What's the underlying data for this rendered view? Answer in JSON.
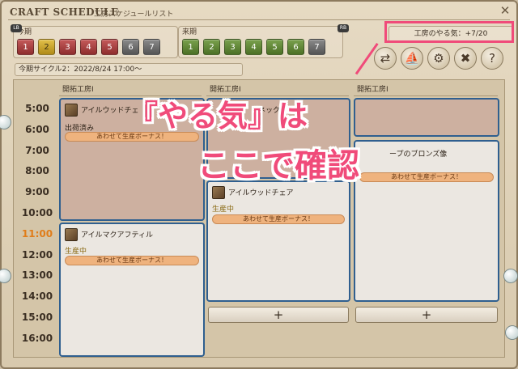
{
  "header": {
    "title": "CRAFT SCHEDULE",
    "subtitle": "工房スケジュールリスト",
    "close_icon": "✕"
  },
  "this_period": {
    "label": "今期",
    "badge": "LB",
    "days": [
      {
        "label": "1",
        "color": "red"
      },
      {
        "label": "2",
        "color": "gold"
      },
      {
        "label": "3",
        "color": "red"
      },
      {
        "label": "4",
        "color": "red"
      },
      {
        "label": "5",
        "color": "red"
      },
      {
        "label": "6",
        "color": "gray"
      },
      {
        "label": "7",
        "color": "gray"
      }
    ]
  },
  "next_period": {
    "label": "来期",
    "badge": "RB",
    "days": [
      {
        "label": "1",
        "color": "green"
      },
      {
        "label": "2",
        "color": "green"
      },
      {
        "label": "3",
        "color": "green"
      },
      {
        "label": "4",
        "color": "green"
      },
      {
        "label": "5",
        "color": "green"
      },
      {
        "label": "6",
        "color": "green"
      },
      {
        "label": "7",
        "color": "gray"
      }
    ]
  },
  "motivation": "工房のやる気：+7/20",
  "tool_icons": [
    "⇄",
    "⛵",
    "⚙",
    "✖",
    "?"
  ],
  "cycle_info": "今期サイクル2：2022/8/24 17:00～",
  "time_labels": [
    "5:00",
    "6:00",
    "7:00",
    "8:00",
    "9:00",
    "10:00",
    "11:00",
    "12:00",
    "13:00",
    "14:00",
    "15:00",
    "16:00"
  ],
  "current_time": "11:00",
  "columns": [
    {
      "header": "開拓工房Ⅰ"
    },
    {
      "header": "開拓工房Ⅰ"
    },
    {
      "header": "開拓工房Ⅰ"
    }
  ],
  "tasks": {
    "t1": {
      "name": "アイルウッドチェ",
      "status": "出荷済み",
      "bonus": "あわせて生産ボーナス！"
    },
    "t2": {
      "name": "アイルマクアフティル",
      "status": "生産中",
      "bonus": "あわせて生産ボーナス！"
    },
    "t3": {
      "name": "ネックレス"
    },
    "t4": {
      "name": "アイルウッドチェア",
      "status": "生産中",
      "bonus": "あわせて生産ボーナス！"
    },
    "t5": {
      "name": "ープのブロンズ像",
      "bonus": "あわせて生産ボーナス！"
    }
  },
  "add_label": "+",
  "overlay": {
    "line1": "『やる気』は",
    "line2": "ここで確認"
  },
  "colors": {
    "accent_pink": "#f04b7a",
    "task_border": "#2f5f8f",
    "current_time": "#e07d1a"
  }
}
